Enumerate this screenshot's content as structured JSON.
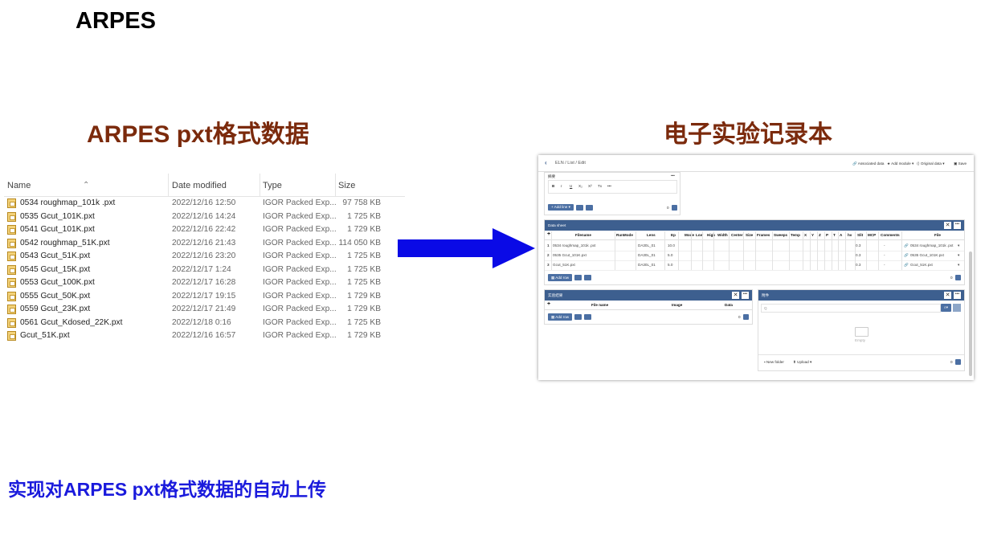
{
  "slide": {
    "title": "ARPES",
    "left_heading": "ARPES pxt格式数据",
    "right_heading": "电子实验记录本",
    "caption": "实现对ARPES pxt格式数据的自动上传"
  },
  "explorer": {
    "columns": [
      "Name",
      "Date modified",
      "Type",
      "Size"
    ],
    "rows": [
      {
        "name": "0534 roughmap_101k .pxt",
        "date": "2022/12/16 12:50",
        "type": "IGOR Packed Exp...",
        "size": "97 758 KB"
      },
      {
        "name": "0535 Gcut_101K.pxt",
        "date": "2022/12/16 14:24",
        "type": "IGOR Packed Exp...",
        "size": "1 725 KB"
      },
      {
        "name": "0541 Gcut_101K.pxt",
        "date": "2022/12/16 22:42",
        "type": "IGOR Packed Exp...",
        "size": "1 729 KB"
      },
      {
        "name": "0542 roughmap_51K.pxt",
        "date": "2022/12/16 21:43",
        "type": "IGOR Packed Exp...",
        "size": "114 050 KB"
      },
      {
        "name": "0543 Gcut_51K.pxt",
        "date": "2022/12/16 23:20",
        "type": "IGOR Packed Exp...",
        "size": "1 725 KB"
      },
      {
        "name": "0545 Gcut_15K.pxt",
        "date": "2022/12/17 1:24",
        "type": "IGOR Packed Exp...",
        "size": "1 725 KB"
      },
      {
        "name": "0553 Gcut_100K.pxt",
        "date": "2022/12/17 16:28",
        "type": "IGOR Packed Exp...",
        "size": "1 725 KB"
      },
      {
        "name": "0555 Gcut_50K.pxt",
        "date": "2022/12/17 19:15",
        "type": "IGOR Packed Exp...",
        "size": "1 729 KB"
      },
      {
        "name": "0559  Gcut_23K.pxt",
        "date": "2022/12/17 21:49",
        "type": "IGOR Packed Exp...",
        "size": "1 729 KB"
      },
      {
        "name": "0561 Gcut_Kdosed_22K.pxt",
        "date": "2022/12/18 0:16",
        "type": "IGOR Packed Exp...",
        "size": "1 725 KB"
      },
      {
        "name": "Gcut_51K.pxt",
        "date": "2022/12/16 16:57",
        "type": "IGOR Packed Exp...",
        "size": "1 729 KB"
      }
    ]
  },
  "eln": {
    "breadcrumb": "ELN / List / Edit",
    "toolbar": [
      "Associated data",
      "Add module",
      "Original data",
      "Save"
    ],
    "editor_label": "摘要",
    "editor_tools": [
      "B",
      "I",
      "U",
      "X₂",
      "X²",
      "Tx",
      "•••"
    ],
    "add_line": "Add line",
    "editor_count": "0",
    "data_sheet": {
      "title": "Data sheet",
      "columns": [
        "+",
        "Filename",
        "RunMode",
        "Lens",
        "Ep",
        "Mode",
        "Low",
        "High",
        "Width",
        "Center",
        "Size",
        "Frames",
        "Sweeps",
        "Temp",
        "X",
        "Y",
        "Z",
        "P",
        "T",
        "A",
        "hv",
        "Slit",
        "MCP",
        "Comments",
        "File"
      ],
      "rows": [
        {
          "idx": "1",
          "filename": "0534 roughmap_101k .pxt",
          "lens": "DA30L_01",
          "ep": "10.0",
          "slit": "0.3",
          "comments": "-",
          "file": "0534 roughmap_101k .pxt"
        },
        {
          "idx": "2",
          "filename": "0535 Gcut_101K.pxt",
          "lens": "DA30L_01",
          "ep": "5.0",
          "slit": "0.3",
          "comments": "-",
          "file": "0535 Gcut_101K.pxt"
        },
        {
          "idx": "3",
          "filename": "Gcut_51K.pxt",
          "lens": "DA30L_01",
          "ep": "5.0",
          "slit": "0.3",
          "comments": "-",
          "file": "Gcut_51K.pxt"
        }
      ],
      "add_row": "Add row",
      "count": "0"
    },
    "results": {
      "title": "实验结果",
      "columns": [
        "+",
        "File name",
        "Image",
        "Data"
      ],
      "add_row": "Add row",
      "count": "0"
    },
    "attachments": {
      "title": "附件",
      "search_placeholder": "Q",
      "empty": "Empty",
      "new_folder": "New folder",
      "upload": "Upload",
      "count": "0"
    }
  },
  "colors": {
    "heading": "#7b2a0c",
    "caption": "#1a1adc",
    "arrow": "#0a0ae6",
    "panel": "#3d5f8f"
  }
}
